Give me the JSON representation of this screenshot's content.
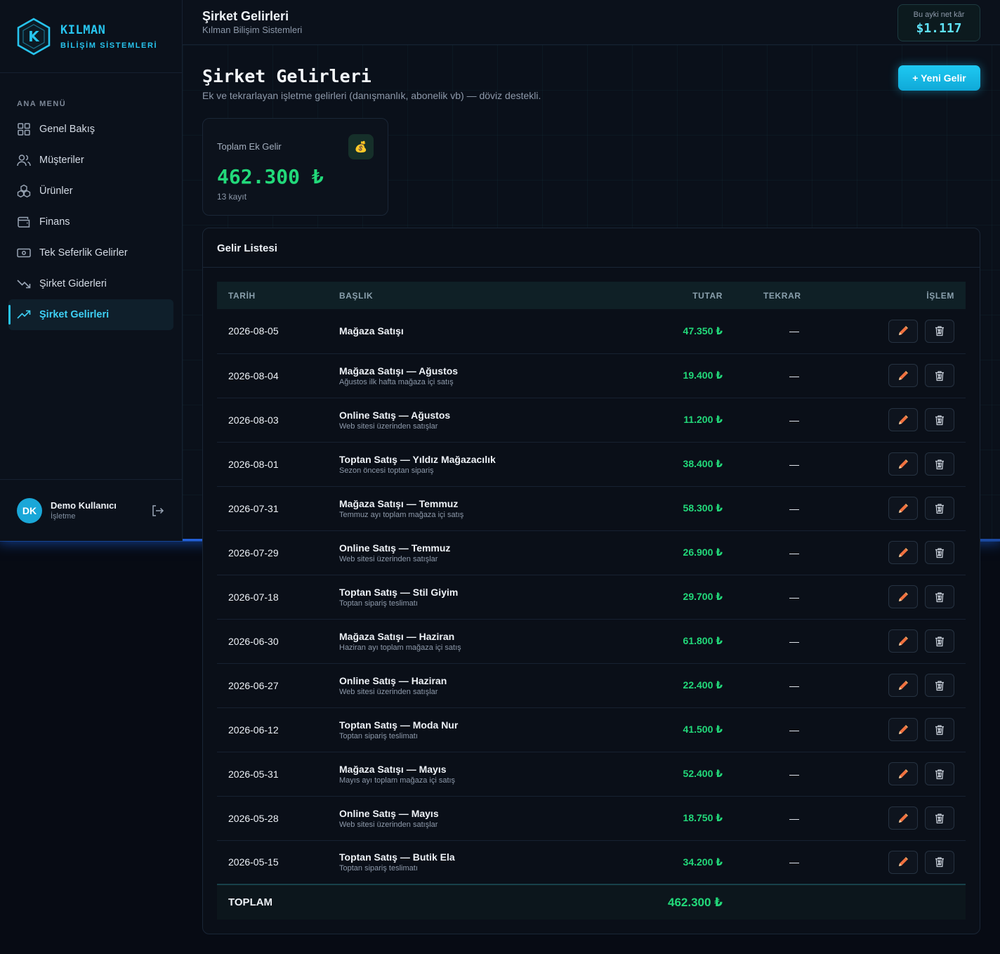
{
  "brand": {
    "name": "KILMAN",
    "subtitle": "BİLİŞİM SİSTEMLERİ",
    "logo_letter": "K"
  },
  "sidebar": {
    "section_title": "ANA MENÜ",
    "items": [
      {
        "label": "Genel Bakış",
        "icon": "grid-icon"
      },
      {
        "label": "Müşteriler",
        "icon": "users-icon"
      },
      {
        "label": "Ürünler",
        "icon": "boxes-icon"
      },
      {
        "label": "Finans",
        "icon": "wallet-icon"
      },
      {
        "label": "Tek Seferlik Gelirler",
        "icon": "cash-icon"
      },
      {
        "label": "Şirket Giderleri",
        "icon": "trending-down-icon"
      },
      {
        "label": "Şirket Gelirleri",
        "icon": "trending-up-icon",
        "active": true
      }
    ],
    "user": {
      "initials": "DK",
      "name": "Demo Kullanıcı",
      "role": "İşletme"
    }
  },
  "topbar": {
    "title": "Şirket Gelirleri",
    "subtitle": "Kılman Bilişim Sistemleri",
    "profit_label": "Bu ayki net kâr",
    "profit_value": "$1.117"
  },
  "page": {
    "title": "Şirket Gelirleri",
    "description": "Ek ve tekrarlayan işletme gelirleri (danışmanlık, abonelik vb) — döviz destekli.",
    "new_button": "+ Yeni Gelir"
  },
  "stat": {
    "label": "Toplam Ek Gelir",
    "value": "462.300 ₺",
    "count": "13 kayıt",
    "icon": "💰"
  },
  "list": {
    "title": "Gelir Listesi",
    "columns": {
      "date": "TARİH",
      "title": "BAŞLIK",
      "amount": "TUTAR",
      "repeat": "TEKRAR",
      "action": "İŞLEM"
    },
    "rows": [
      {
        "date": "2026-08-05",
        "title": "Mağaza Satışı",
        "sub": "",
        "amount": "47.350 ₺",
        "repeat": "—"
      },
      {
        "date": "2026-08-04",
        "title": "Mağaza Satışı — Ağustos",
        "sub": "Ağustos ilk hafta mağaza içi satış",
        "amount": "19.400 ₺",
        "repeat": "—"
      },
      {
        "date": "2026-08-03",
        "title": "Online Satış — Ağustos",
        "sub": "Web sitesi üzerinden satışlar",
        "amount": "11.200 ₺",
        "repeat": "—"
      },
      {
        "date": "2026-08-01",
        "title": "Toptan Satış — Yıldız Mağazacılık",
        "sub": "Sezon öncesi toptan sipariş",
        "amount": "38.400 ₺",
        "repeat": "—"
      },
      {
        "date": "2026-07-31",
        "title": "Mağaza Satışı — Temmuz",
        "sub": "Temmuz ayı toplam mağaza içi satış",
        "amount": "58.300 ₺",
        "repeat": "—"
      },
      {
        "date": "2026-07-29",
        "title": "Online Satış — Temmuz",
        "sub": "Web sitesi üzerinden satışlar",
        "amount": "26.900 ₺",
        "repeat": "—"
      },
      {
        "date": "2026-07-18",
        "title": "Toptan Satış — Stil Giyim",
        "sub": "Toptan sipariş teslimatı",
        "amount": "29.700 ₺",
        "repeat": "—"
      },
      {
        "date": "2026-06-30",
        "title": "Mağaza Satışı — Haziran",
        "sub": "Haziran ayı toplam mağaza içi satış",
        "amount": "61.800 ₺",
        "repeat": "—"
      },
      {
        "date": "2026-06-27",
        "title": "Online Satış — Haziran",
        "sub": "Web sitesi üzerinden satışlar",
        "amount": "22.400 ₺",
        "repeat": "—"
      },
      {
        "date": "2026-06-12",
        "title": "Toptan Satış — Moda Nur",
        "sub": "Toptan sipariş teslimatı",
        "amount": "41.500 ₺",
        "repeat": "—"
      },
      {
        "date": "2026-05-31",
        "title": "Mağaza Satışı — Mayıs",
        "sub": "Mayıs ayı toplam mağaza içi satış",
        "amount": "52.400 ₺",
        "repeat": "—"
      },
      {
        "date": "2026-05-28",
        "title": "Online Satış — Mayıs",
        "sub": "Web sitesi üzerinden satışlar",
        "amount": "18.750 ₺",
        "repeat": "—"
      },
      {
        "date": "2026-05-15",
        "title": "Toptan Satış — Butik Ela",
        "sub": "Toptan sipariş teslimatı",
        "amount": "34.200 ₺",
        "repeat": "—"
      }
    ],
    "total_label": "TOPLAM",
    "total_value": "462.300 ₺"
  }
}
